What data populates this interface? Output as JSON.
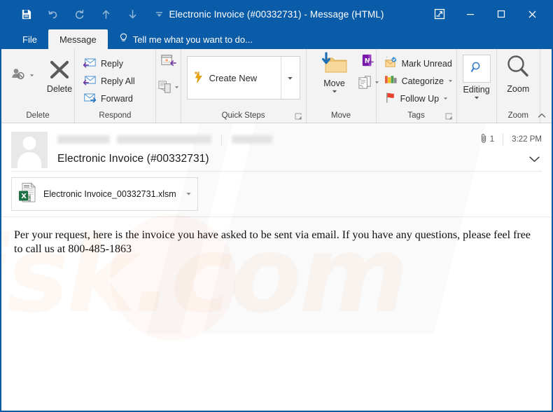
{
  "window": {
    "title": "Electronic Invoice (#00332731) - Message (HTML)",
    "accent_color": "#0a5ca8",
    "ribbon_bg": "#f3f3f3"
  },
  "quick_access_toolbar": {
    "items": [
      {
        "name": "save-icon",
        "label": "Save"
      },
      {
        "name": "undo-icon",
        "label": "Undo"
      },
      {
        "name": "redo-icon",
        "label": "Redo"
      },
      {
        "name": "previous-item-icon",
        "label": "Previous Item"
      },
      {
        "name": "next-item-icon",
        "label": "Next Item"
      },
      {
        "name": "customize-qat-icon",
        "label": "Customize Quick Access Toolbar"
      }
    ]
  },
  "window_controls": [
    {
      "name": "ribbon-display-options-icon",
      "label": "Ribbon Display Options"
    },
    {
      "name": "minimize-icon",
      "label": "Minimize"
    },
    {
      "name": "maximize-icon",
      "label": "Maximize"
    },
    {
      "name": "close-icon",
      "label": "Close"
    }
  ],
  "tabs": {
    "file": "File",
    "message": "Message",
    "tell_me": "Tell me what you want to do...",
    "tell_me_icon": "lightbulb-icon"
  },
  "ribbon": {
    "groups": [
      {
        "label": "Delete",
        "commands": [
          {
            "name": "ignore-button",
            "label": "Ignore",
            "icon": "ignore-person-block-icon"
          },
          {
            "name": "delete-button",
            "label": "Delete",
            "icon": "delete-x-icon"
          }
        ]
      },
      {
        "label": "Respond",
        "commands": [
          {
            "name": "reply-button",
            "label": "Reply",
            "icon": "reply-envelope-icon"
          },
          {
            "name": "reply-all-button",
            "label": "Reply All",
            "icon": "reply-all-envelope-icon"
          },
          {
            "name": "forward-button",
            "label": "Forward",
            "icon": "forward-envelope-icon"
          },
          {
            "name": "meeting-button",
            "label": "Meeting",
            "icon": "calendar-reply-icon"
          },
          {
            "name": "more-respond-button",
            "label": "More",
            "icon": "more-respond-icon"
          }
        ]
      },
      {
        "label": "Quick Steps",
        "has_dialog_launcher": true,
        "commands": [
          {
            "name": "create-new-quick-step",
            "label": "Create New",
            "icon": "lightning-bolt-icon"
          },
          {
            "name": "quick-steps-more",
            "label": "More",
            "icon": "chevron-down-icon"
          }
        ]
      },
      {
        "label": "Move",
        "commands": [
          {
            "name": "move-button",
            "label": "Move",
            "icon": "move-folder-icon"
          },
          {
            "name": "onenote-button",
            "label": "OneNote",
            "icon": "onenote-icon"
          },
          {
            "name": "rules-button",
            "label": "Rules",
            "icon": "rules-page-icon"
          }
        ]
      },
      {
        "label": "Tags",
        "has_dialog_launcher": true,
        "commands": [
          {
            "name": "mark-unread-button",
            "label": "Mark Unread",
            "icon": "mark-unread-envelope-icon"
          },
          {
            "name": "categorize-button",
            "label": "Categorize",
            "icon": "categorize-colors-icon"
          },
          {
            "name": "follow-up-button",
            "label": "Follow Up",
            "icon": "flag-icon"
          }
        ]
      },
      {
        "label": "",
        "commands": [
          {
            "name": "editing-button",
            "label": "Editing",
            "icon": "editing-magnifier-icon"
          }
        ]
      },
      {
        "label": "Zoom",
        "commands": [
          {
            "name": "zoom-button",
            "label": "Zoom",
            "icon": "zoom-magnifier-icon"
          }
        ]
      }
    ],
    "collapse_icon": "chevron-up-icon"
  },
  "message": {
    "sender_redacted": true,
    "subject": "Electronic Invoice (#00332731)",
    "attachment_count": "1",
    "attachment_icon": "paperclip-icon",
    "time": "3:22 PM",
    "expand_icon": "chevron-down-icon",
    "attachment": {
      "filename": "Electronic Invoice_00332731.xlsm",
      "icon": "excel-macro-file-icon",
      "caret_icon": "chevron-down-icon"
    },
    "body": "Per your request, here is the invoice you have asked to be sent via email. If you have any questions, please feel free to call us at 800-485-1863"
  },
  "watermark": {
    "text": "risk.com"
  }
}
